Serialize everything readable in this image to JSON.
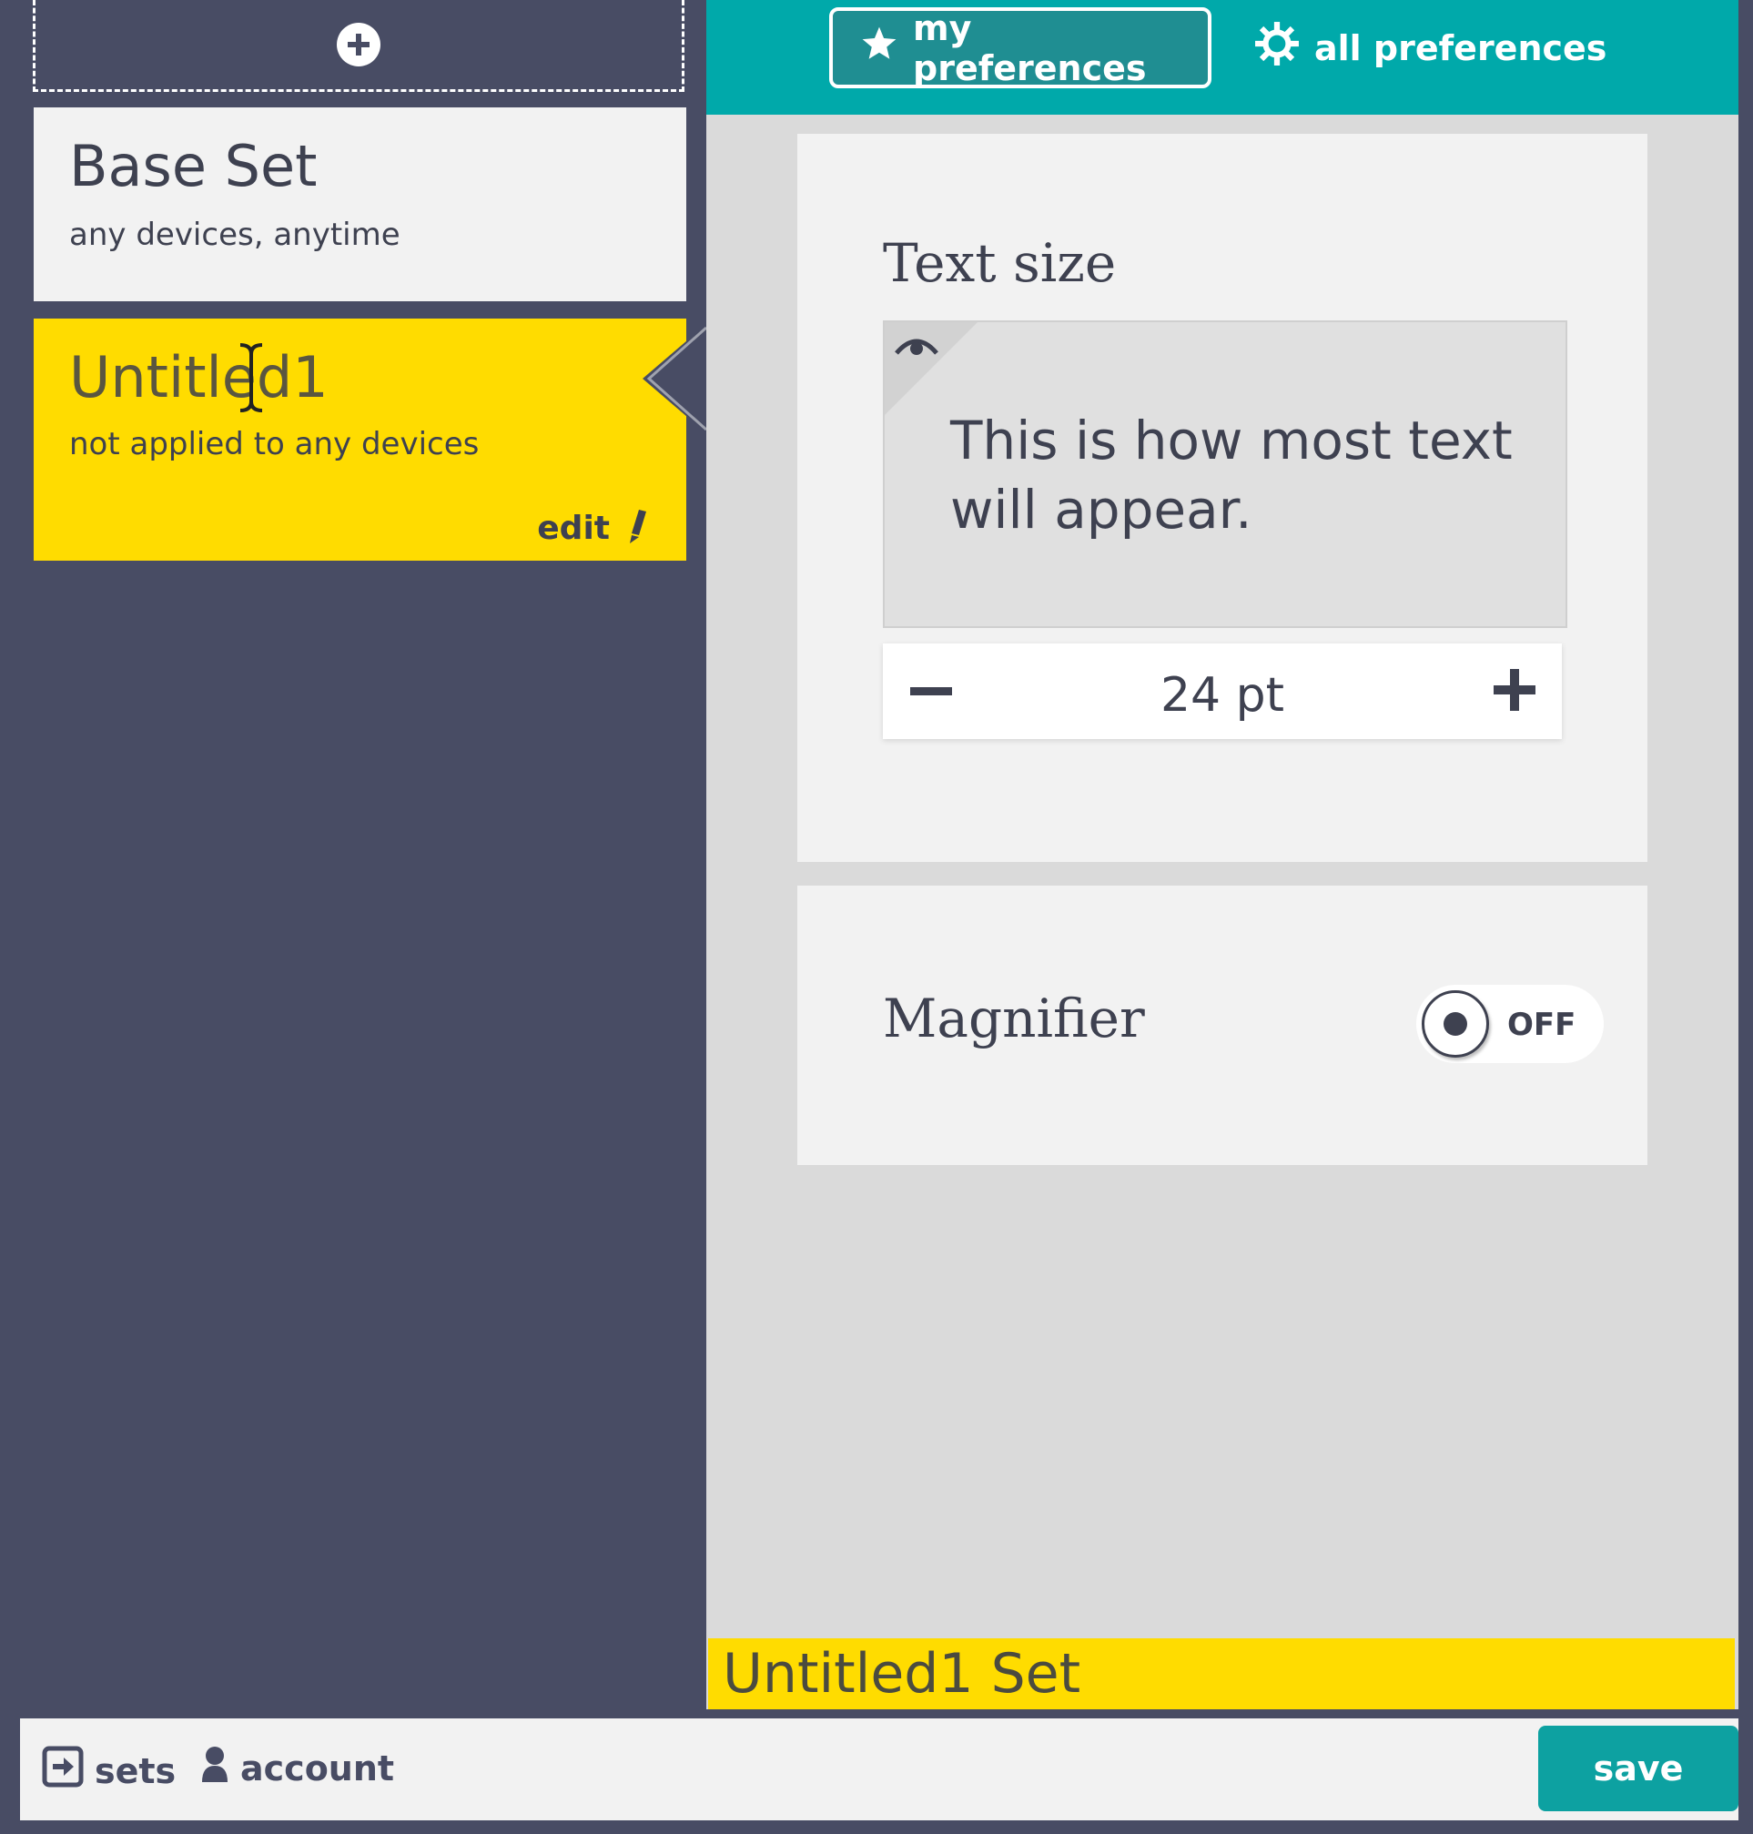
{
  "sidebar": {
    "add_set_icon": "plus-circle-icon",
    "sets": [
      {
        "title": "Base Set",
        "subtitle": "any devices, anytime"
      },
      {
        "title": "Untitled1",
        "subtitle": "not applied to any devices",
        "edit_label": "edit",
        "edit_icon": "pencil-icon"
      }
    ]
  },
  "tabs": {
    "my_preferences": {
      "label": "my preferences",
      "icon": "star-icon"
    },
    "all_preferences": {
      "label": "all preferences",
      "icon": "gear-icon"
    }
  },
  "preferences": {
    "text_size": {
      "heading": "Text size",
      "preview_text": "This is how most text will appear.",
      "preview_icon": "eye-icon",
      "value": "24 pt"
    },
    "magnifier": {
      "heading": "Magnifier",
      "state": "OFF"
    }
  },
  "current_set_banner": "Untitled1 Set",
  "footer": {
    "sets_label": "sets",
    "account_label": "account",
    "save_label": "save"
  },
  "colors": {
    "sidebar_bg": "#484c64",
    "accent_teal": "#00a9aa",
    "highlight_yellow": "#ffdc00",
    "card_bg": "#f2f2f2",
    "panel_bg": "#dadada",
    "text_dark": "#3e4150"
  }
}
